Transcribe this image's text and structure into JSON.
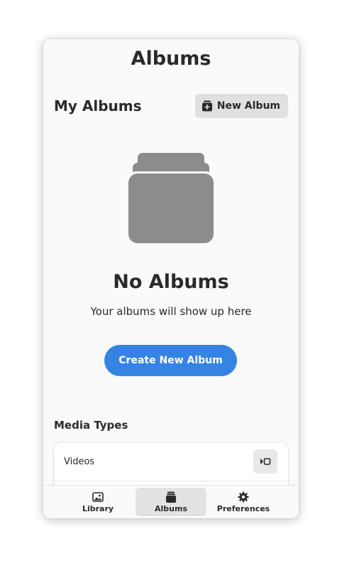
{
  "header": {
    "title": "Albums"
  },
  "my_albums": {
    "heading": "My Albums",
    "new_album_label": "New Album",
    "new_album_icon": "new-album-icon"
  },
  "empty_state": {
    "icon": "albums-stack-icon",
    "title": "No Albums",
    "subtitle": "Your albums will show up here",
    "create_label": "Create New Album"
  },
  "media_types": {
    "heading": "Media Types",
    "items": [
      {
        "label": "Videos",
        "icon": "video-icon"
      }
    ]
  },
  "bottom_nav": {
    "tabs": [
      {
        "label": "Library",
        "icon": "image-icon",
        "active": false
      },
      {
        "label": "Albums",
        "icon": "albums-icon",
        "active": true
      },
      {
        "label": "Preferences",
        "icon": "gear-icon",
        "active": false
      }
    ]
  },
  "colors": {
    "accent": "#3584e4",
    "icon_gray": "#8c8c8c",
    "text": "#2a2a2a",
    "window_bg": "#fafafa"
  }
}
